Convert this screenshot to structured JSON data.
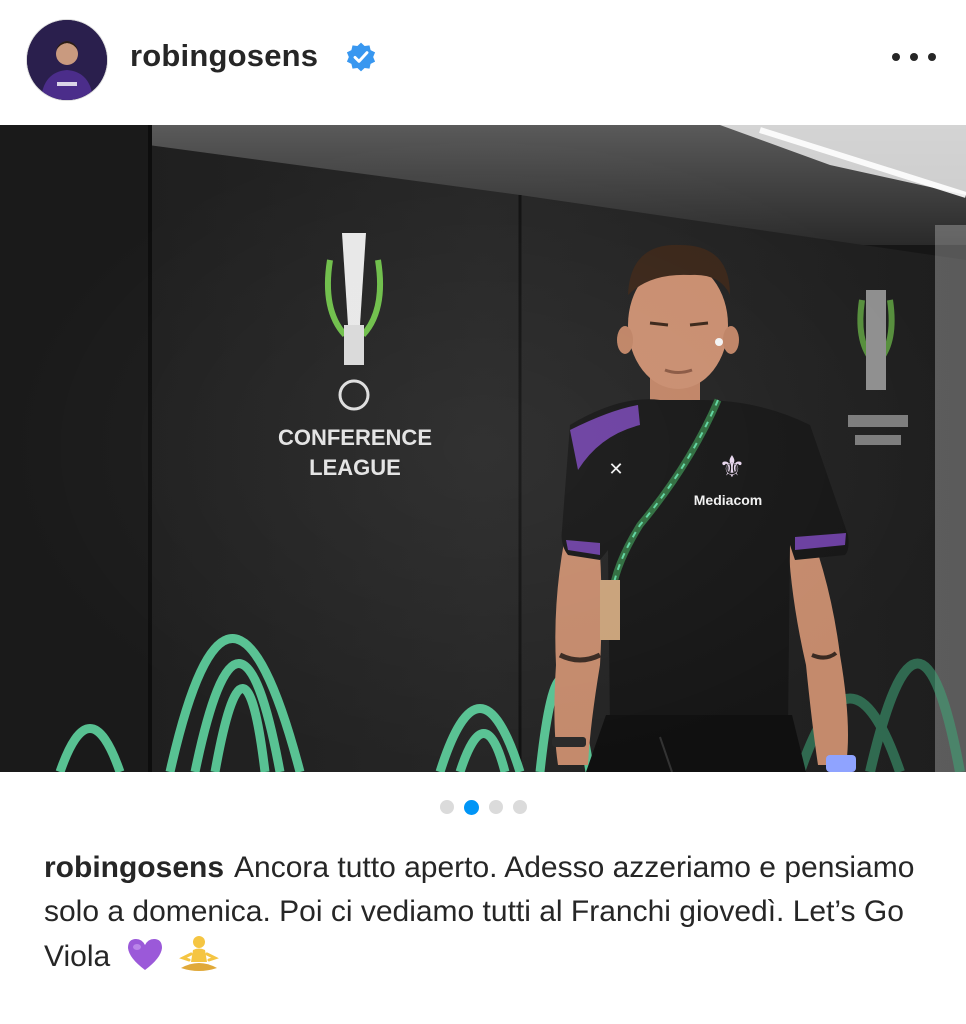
{
  "post": {
    "username": "robingosens",
    "verified": true,
    "carousel": {
      "count": 4,
      "active_index": 1
    }
  },
  "photo": {
    "wall_logo_lines": [
      "CONFERENCE",
      "LEAGUE"
    ],
    "shirt_text": "Mediacom"
  },
  "caption": {
    "username": "robingosens",
    "text": "Ancora tutto aperto. Adesso azzeriamo e pensiamo solo a domenica. Poi ci vediamo tutti al Franchi giovedì. Let’s Go Viola",
    "emojis": [
      "purple-heart",
      "person-in-lotus-position"
    ]
  },
  "colors": {
    "verified_blue": "#3897f0",
    "dot_active": "#0095f6",
    "dot_inactive": "#dbdbdb",
    "conference_green": "#5fd4a0",
    "fiorentina_purple": "#6b3fa0"
  }
}
